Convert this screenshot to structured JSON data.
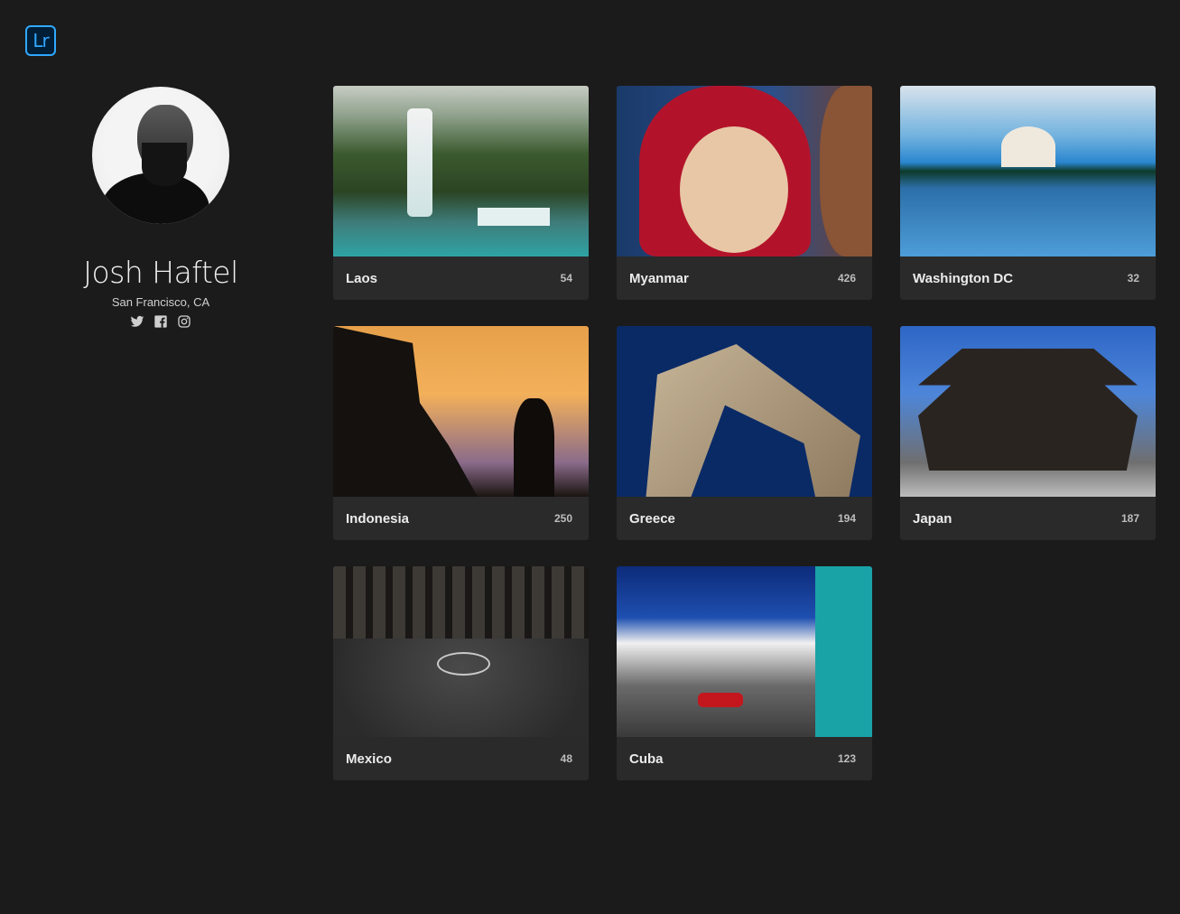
{
  "app": {
    "logo_text": "Lr"
  },
  "profile": {
    "name": "Josh Haftel",
    "location": "San Francisco, CA",
    "social": [
      "twitter-icon",
      "facebook-icon",
      "instagram-icon"
    ]
  },
  "albums": [
    {
      "title": "Laos",
      "count": "54"
    },
    {
      "title": "Myanmar",
      "count": "426"
    },
    {
      "title": "Washington DC",
      "count": "32"
    },
    {
      "title": "Indonesia",
      "count": "250"
    },
    {
      "title": "Greece",
      "count": "194"
    },
    {
      "title": "Japan",
      "count": "187"
    },
    {
      "title": "Mexico",
      "count": "48"
    },
    {
      "title": "Cuba",
      "count": "123"
    }
  ],
  "colors": {
    "background": "#1b1b1b",
    "card": "#2a2a2a",
    "accent": "#31a8ff"
  }
}
